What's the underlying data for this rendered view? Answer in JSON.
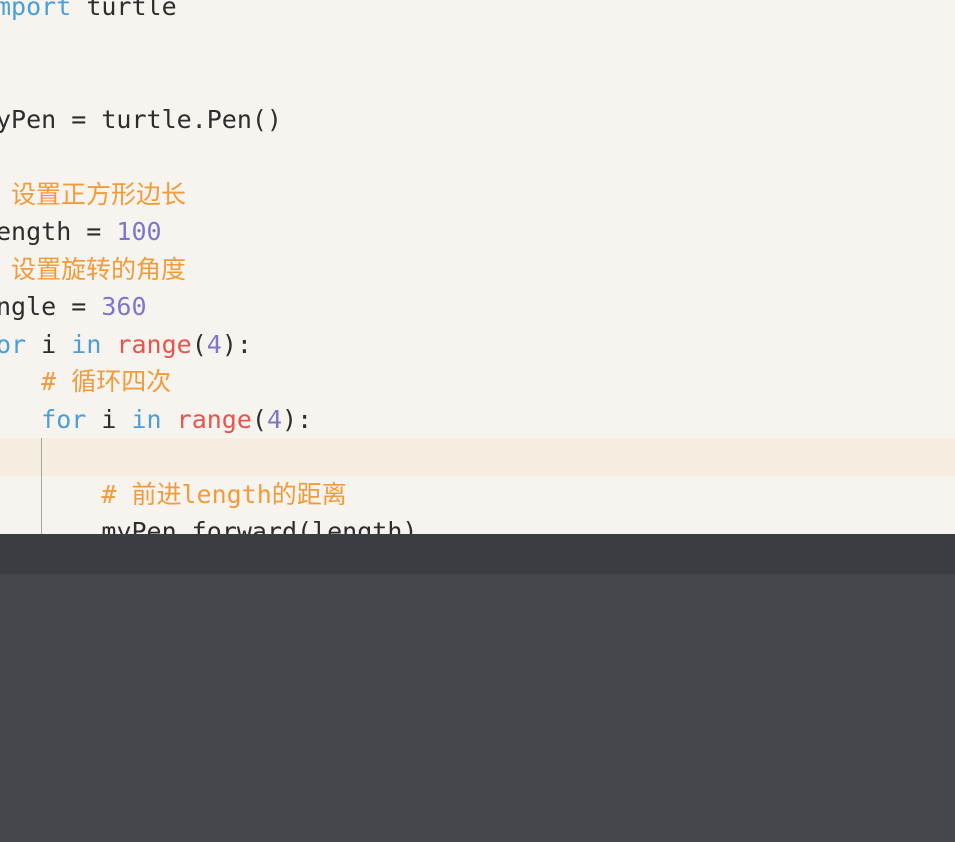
{
  "editor": {
    "language": "python",
    "lines": [
      {
        "tokens": [
          {
            "text": "mport",
            "color": "#4a9fd8"
          },
          {
            "text": " turtle",
            "color": "#2d2d2d"
          }
        ]
      },
      {
        "tokens": []
      },
      {
        "tokens": []
      },
      {
        "tokens": [
          {
            "text": "yPen = turtle.Pen()",
            "color": "#2d2d2d"
          }
        ]
      },
      {
        "tokens": []
      },
      {
        "tokens": [
          {
            "text": " 设置正方形边长",
            "color": "#f29b3a"
          }
        ]
      },
      {
        "tokens": [
          {
            "text": "ength = ",
            "color": "#2d2d2d"
          },
          {
            "text": "100",
            "color": "#7f76c9"
          }
        ]
      },
      {
        "tokens": [
          {
            "text": " 设置旋转的角度",
            "color": "#f29b3a"
          }
        ]
      },
      {
        "tokens": [
          {
            "text": "ngle = ",
            "color": "#2d2d2d"
          },
          {
            "text": "360",
            "color": "#7f76c9"
          }
        ]
      },
      {
        "tokens": [
          {
            "text": "or",
            "color": "#4a9fd8"
          },
          {
            "text": " i ",
            "color": "#2d2d2d"
          },
          {
            "text": "in",
            "color": "#4a9fd8"
          },
          {
            "text": " ",
            "color": "#2d2d2d"
          },
          {
            "text": "range",
            "color": "#e8534c"
          },
          {
            "text": "(",
            "color": "#2d2d2d"
          },
          {
            "text": "4",
            "color": "#7f76c9"
          },
          {
            "text": "):",
            "color": "#2d2d2d"
          }
        ]
      },
      {
        "tokens": [
          {
            "text": "   ",
            "color": "#2d2d2d"
          },
          {
            "text": "# 循环四次",
            "color": "#f29b3a"
          }
        ]
      },
      {
        "tokens": [
          {
            "text": "   ",
            "color": "#2d2d2d"
          },
          {
            "text": "for",
            "color": "#4a9fd8"
          },
          {
            "text": " i ",
            "color": "#2d2d2d"
          },
          {
            "text": "in",
            "color": "#4a9fd8"
          },
          {
            "text": " ",
            "color": "#2d2d2d"
          },
          {
            "text": "range",
            "color": "#e8534c"
          },
          {
            "text": "(",
            "color": "#2d2d2d"
          },
          {
            "text": "4",
            "color": "#7f76c9"
          },
          {
            "text": "):",
            "color": "#2d2d2d"
          }
        ]
      },
      {
        "tokens": [],
        "active": true
      },
      {
        "tokens": [
          {
            "text": "       ",
            "color": "#2d2d2d"
          },
          {
            "text": "# 前进length的距离",
            "color": "#f29b3a"
          }
        ]
      },
      {
        "tokens": [
          {
            "text": "       myPen.forward(length)",
            "color": "#2d2d2d"
          }
        ]
      }
    ]
  },
  "colors": {
    "editor_background": "#f7f4ef",
    "active_line": "#f5eee0",
    "panel_background": "#43464b",
    "panel_header": "#3a3d41"
  }
}
